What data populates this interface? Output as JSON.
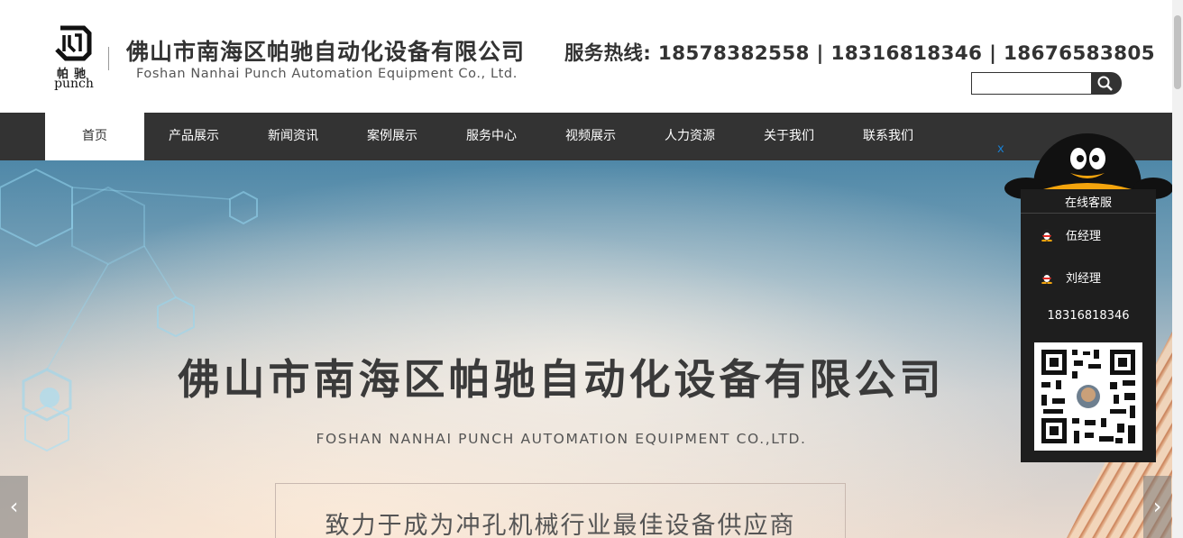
{
  "header": {
    "logo_cn": "帕驰",
    "logo_en": "punch",
    "company_cn": "佛山市南海区帕驰自动化设备有限公司",
    "company_en": "Foshan Nanhai Punch Automation Equipment Co., Ltd.",
    "hotline": "服务热线: 18578382558 | 18316818346 | 18676583805",
    "search_placeholder": ""
  },
  "nav": {
    "items": [
      {
        "label": "首页",
        "active": true
      },
      {
        "label": "产品展示"
      },
      {
        "label": "新闻资讯"
      },
      {
        "label": "案例展示"
      },
      {
        "label": "服务中心"
      },
      {
        "label": "视频展示"
      },
      {
        "label": "人力资源"
      },
      {
        "label": "关于我们"
      },
      {
        "label": "联系我们"
      }
    ]
  },
  "banner": {
    "title": "佛山市南海区帕驰自动化设备有限公司",
    "subtitle": "FOSHAN NANHAI PUNCH AUTOMATION EQUIPMENT CO.,LTD.",
    "slogan": "致力于成为冲孔机械行业最佳设备供应商",
    "prev": "‹",
    "next": "›"
  },
  "service": {
    "close": "x",
    "title": "在线客服",
    "contacts": [
      {
        "label": "伍经理",
        "icon": "qq-penguin-icon"
      },
      {
        "label": "刘经理",
        "icon": "qq-penguin-icon"
      }
    ],
    "phone": "18316818346",
    "qr_icon": "qr-code-icon"
  },
  "colors": {
    "nav_bg": "#333333",
    "nav_active_bg": "#ffffff",
    "service_bg": "#1e1e1e",
    "close_link": "#1a7fd1"
  }
}
